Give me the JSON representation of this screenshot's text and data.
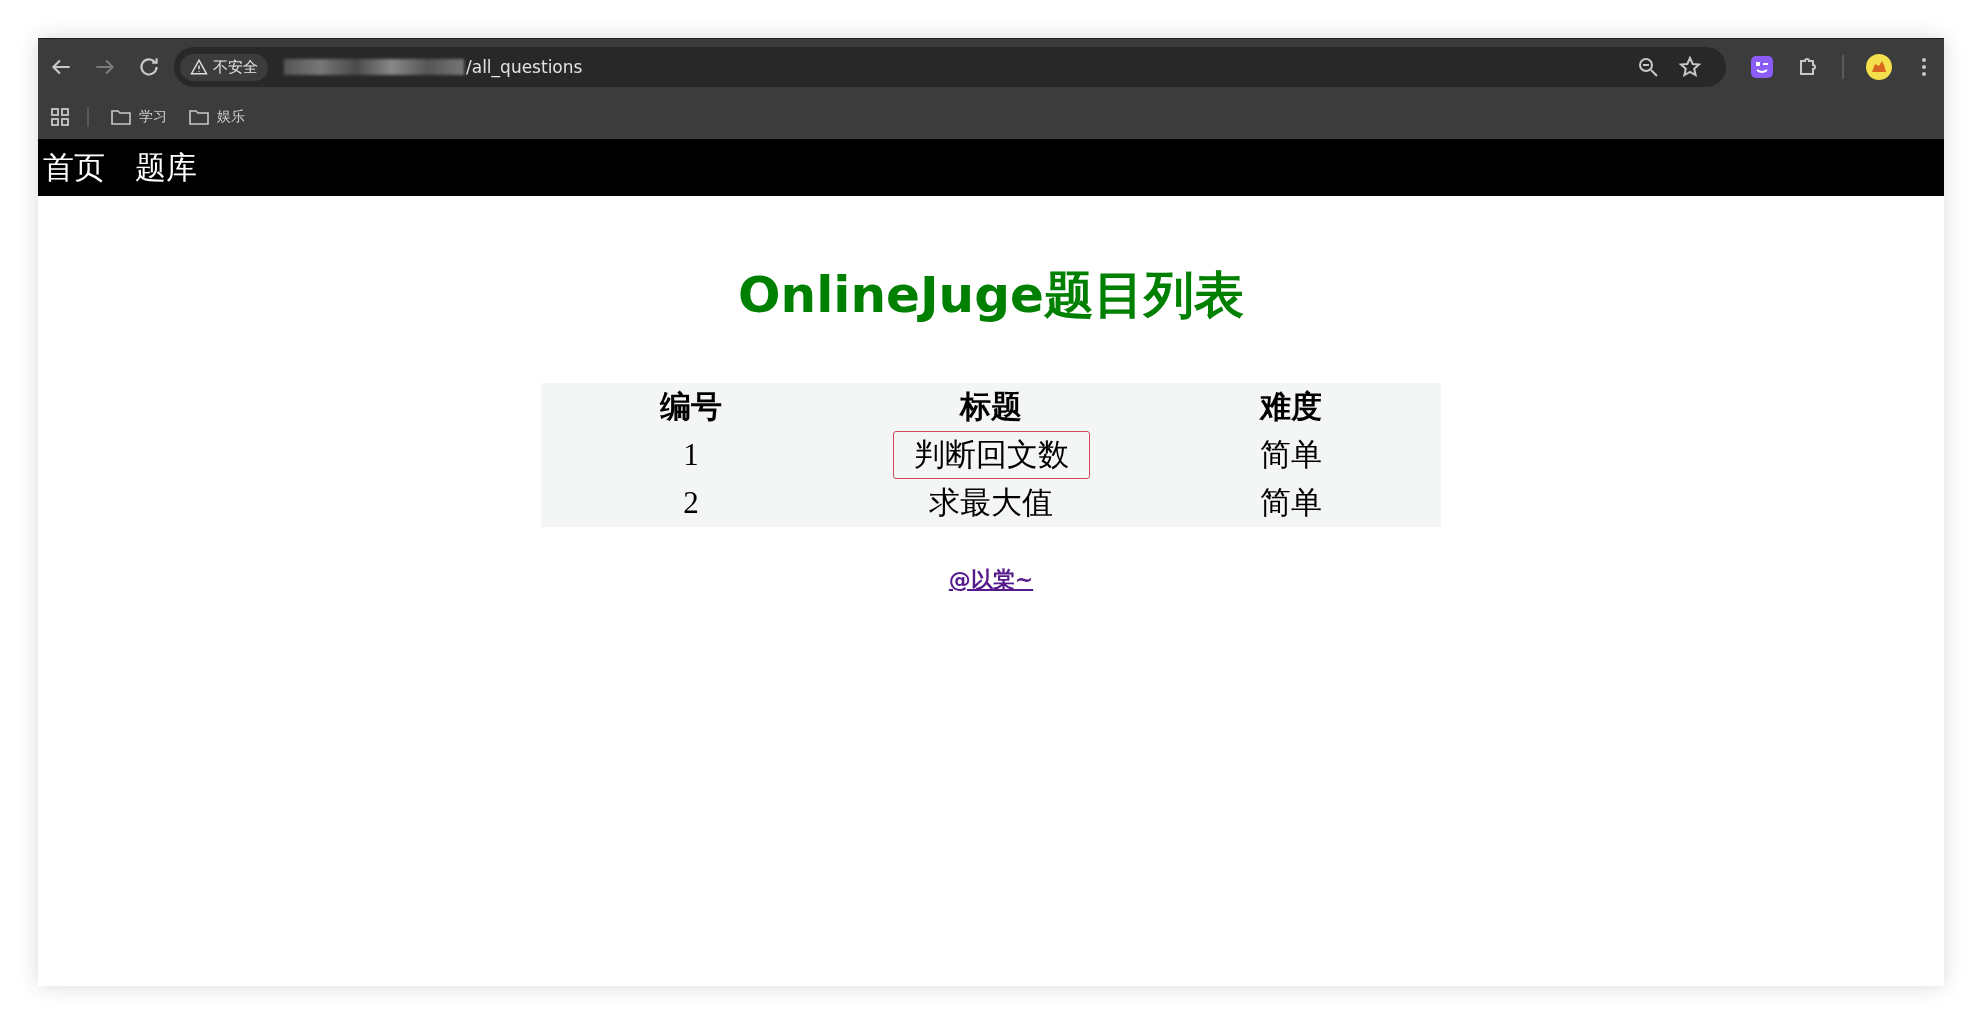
{
  "browser": {
    "security_label": "不安全",
    "url": "/all_questions",
    "bookmarks": [
      "学习",
      "娱乐"
    ]
  },
  "nav": [
    {
      "label": "首页"
    },
    {
      "label": "题库"
    }
  ],
  "heading": "OnlineJuge题目列表",
  "table": {
    "columns": [
      "编号",
      "标题",
      "难度"
    ],
    "rows": [
      {
        "cells": [
          "1",
          "判断回文数",
          "简单"
        ],
        "outlined": true
      },
      {
        "cells": [
          "2",
          "求最大值",
          "简单"
        ],
        "outlined": false
      }
    ]
  },
  "footer_link": "@以棠~"
}
